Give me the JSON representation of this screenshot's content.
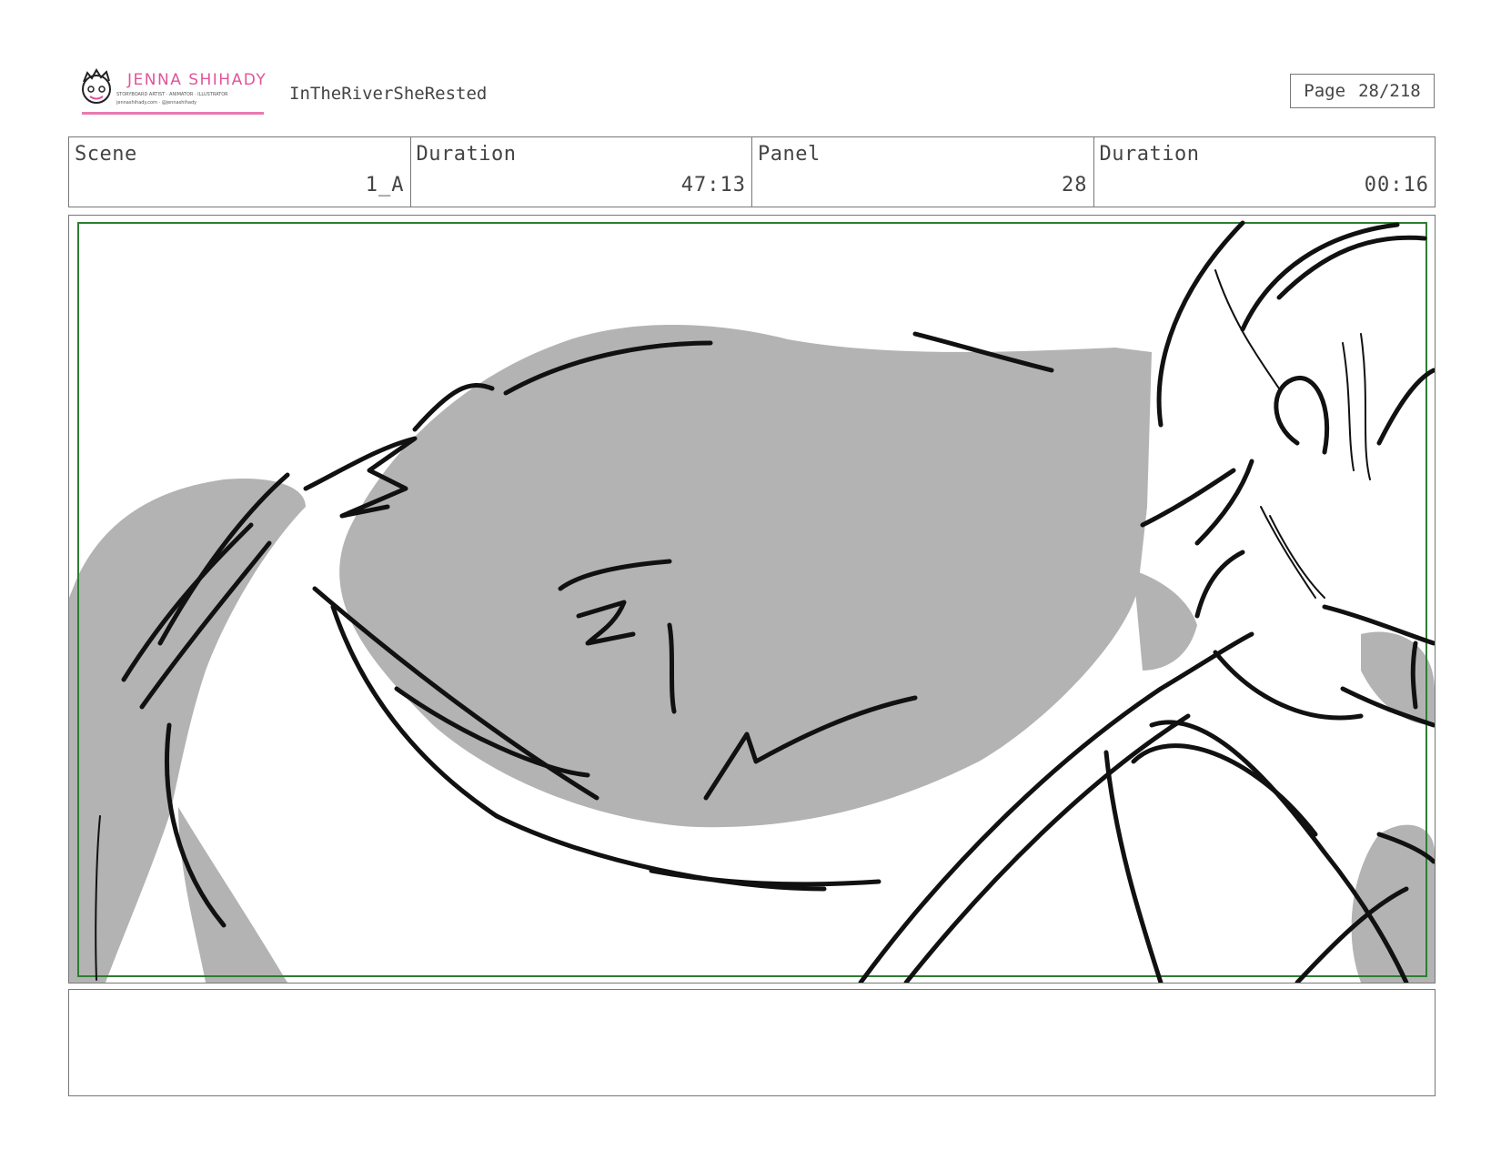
{
  "header": {
    "logo": {
      "name": "JENNA SHIHADY",
      "small_text_1": "STORYBOARD ARTIST · ANIMATOR · ILLUSTRATOR",
      "small_text_2": "jennashihady.com · @jennashihady"
    },
    "project_title": "InTheRiverSheRested",
    "page": {
      "label": "Page",
      "value": "28/218"
    }
  },
  "info_bar": {
    "cells": [
      {
        "label": "Scene",
        "value": "1_A"
      },
      {
        "label": "Duration",
        "value": "47:13"
      },
      {
        "label": "Panel",
        "value": "28"
      },
      {
        "label": "Duration",
        "value": "00:16"
      }
    ]
  },
  "panel": {
    "frame_color": "#2e7d32",
    "fill_color": "#b3b3b3",
    "line_color": "#111111"
  },
  "notes": {
    "text": ""
  }
}
